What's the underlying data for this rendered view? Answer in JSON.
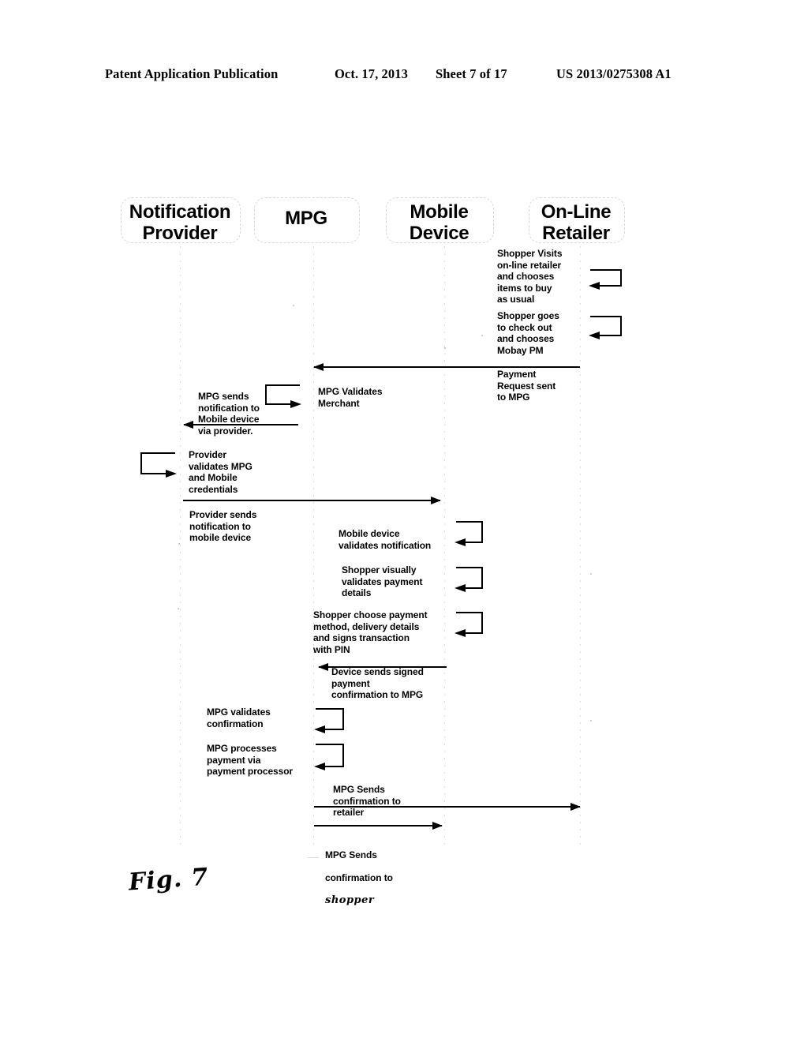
{
  "page_header": {
    "publication": "Patent Application Publication",
    "date": "Oct. 17, 2013",
    "sheet": "Sheet 7 of 17",
    "patent_number": "US 2013/0275308 A1"
  },
  "figure": {
    "caption": "Fig. 7",
    "type": "sequence-diagram"
  },
  "lanes": [
    {
      "id": "notification-provider",
      "line1": "Notification",
      "line2": "Provider"
    },
    {
      "id": "mpg",
      "line1": "MPG",
      "line2": ""
    },
    {
      "id": "mobile-device",
      "line1": "Mobile",
      "line2": "Device"
    },
    {
      "id": "online-retailer",
      "line1": "On-Line",
      "line2": "Retailer"
    }
  ],
  "steps": [
    {
      "id": "shopper-visits",
      "lane": "online-retailer",
      "kind": "self-loop",
      "text": "Shopper Visits\non-line retailer\nand chooses\nitems to buy\nas usual"
    },
    {
      "id": "shopper-checkout",
      "lane": "online-retailer",
      "kind": "self-loop",
      "text": "Shopper goes\nto check out\nand chooses\nMobay PM"
    },
    {
      "id": "payment-request",
      "from": "online-retailer",
      "to": "mpg",
      "kind": "message-left",
      "text": "Payment\nRequest sent\nto MPG"
    },
    {
      "id": "mpg-validates-merchant",
      "lane": "mpg",
      "kind": "label",
      "text": "MPG Validates\nMerchant"
    },
    {
      "id": "mpg-sends-notification",
      "lane": "mpg",
      "kind": "self-loop-right",
      "text": "MPG sends\nnotification to\nMobile device\nvia  provider."
    },
    {
      "id": "mpg-to-provider",
      "from": "mpg",
      "to": "notification-provider",
      "kind": "message-left",
      "text": ""
    },
    {
      "id": "provider-validates",
      "lane": "notification-provider",
      "kind": "self-loop-right",
      "text": "Provider\nvalidates MPG\nand Mobile\ncredentials"
    },
    {
      "id": "provider-sends-notification",
      "from": "notification-provider",
      "to": "mobile-device",
      "kind": "message-right",
      "text": "Provider sends\nnotification to\nmobile device"
    },
    {
      "id": "device-validates-notification",
      "lane": "mobile-device",
      "kind": "self-loop",
      "text": "Mobile device\nvalidates notification"
    },
    {
      "id": "shopper-validates-payment",
      "lane": "mobile-device",
      "kind": "self-loop",
      "text": "Shopper visually\nvalidates payment\ndetails"
    },
    {
      "id": "shopper-chooses-payment",
      "lane": "mobile-device",
      "kind": "self-loop",
      "text": "Shopper choose payment\nmethod, delivery details\nand signs transaction\nwith PIN"
    },
    {
      "id": "device-sends-confirmation",
      "from": "mobile-device",
      "to": "mpg",
      "kind": "message-left",
      "text": "Device sends signed\npayment\nconfirmation to MPG"
    },
    {
      "id": "mpg-validates-confirmation",
      "lane": "mpg",
      "kind": "self-loop",
      "text": "MPG validates\nconfirmation"
    },
    {
      "id": "mpg-processes-payment",
      "lane": "mpg",
      "kind": "self-loop",
      "text": "MPG processes\npayment via\npayment processor"
    },
    {
      "id": "mpg-confirms-retailer",
      "from": "mpg",
      "to": "online-retailer",
      "kind": "message-right",
      "text": "MPG Sends\nconfirmation to\nretailer"
    },
    {
      "id": "mpg-confirms-shopper",
      "from": "mpg",
      "to": "mobile-device",
      "kind": "message-right",
      "text_line1": "MPG Sends",
      "text_line2": "confirmation to",
      "text_line3": "shopper"
    }
  ]
}
